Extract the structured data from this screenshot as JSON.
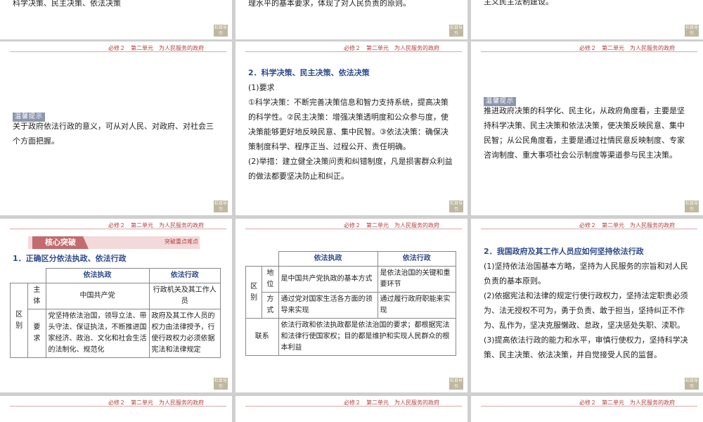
{
  "header_text": "必修２　第二单元　为人民服务的政府",
  "nav_label": "栏目导引",
  "slides": {
    "s1": {
      "text": "科学决策、民主决策、依法决策"
    },
    "s2": {
      "text": "理水平的基本要求，体现了对人民负责的原则。"
    },
    "s3": {
      "text": "主义民主法制建设。"
    },
    "s4": {
      "tip": "温馨提示",
      "lines": [
        "关于政府依法行政的意义，可从对人民、对政府、对社会三",
        "个方面把握。"
      ]
    },
    "s5": {
      "title": "2．科学决策、民主决策、依法决策",
      "lines": [
        "(1)要求",
        "①科学决策：不断完善决策信息和智力支持系统，提高决策",
        "的科学性。②民主决策：增强决策透明度和公众参与度，使",
        "决策能够更好地反映民意、集中民智。③依法决策：确保决",
        "策制度科学、程序正当、过程公开、责任明确。",
        "(2)举措：建立健全决策问责和纠错制度，凡是损害群众利益",
        "的做法都要坚决防止和纠正。"
      ]
    },
    "s6": {
      "tip": "温馨提示",
      "lines": [
        "推进政府决策的科学化、民主化，从政府角度看，主要是坚",
        "持科学决策、民主决策和依法决策，使决策反映民意、集中",
        "民智；从公民角度看，主要是通过社情民意反映制度、专家",
        "咨询制度、重大事项社会公示制度等渠道参与民主决策。"
      ]
    },
    "s7": {
      "core_title": "核心突破",
      "core_sub": "突破重点难点",
      "title": "1．正确区分依法执政、依法行政",
      "table": {
        "head": [
          "依法执政",
          "依法行政"
        ],
        "group": "区别",
        "row1_label": "主体",
        "row1": [
          "中国共产党",
          "行政机关及其工作人员"
        ],
        "row2_label": "要求",
        "row2": [
          "党坚持依法治国，领导立法、带头守法、保证执法，不断推进国家经济、政治、文化和社会生活的法制化、规范化",
          "政府及其工作人员的权力由法律授予，行使行政权力必须依据宪法和法律规定"
        ]
      }
    },
    "s8": {
      "table": {
        "head": [
          "依法执政",
          "依法行政"
        ],
        "group": "区别",
        "row1_label": "地位",
        "row1": [
          "是中国共产党执政的基本方式",
          "是依法治国的关键和重要环节"
        ],
        "row2_label": "方式",
        "row2": [
          "通过党对国家生活各方面的领导来实现",
          "通过履行政府职能来实现"
        ],
        "link_label": "联系",
        "link": "依法行政和依法执政都是依法治国的要求；都根据宪法和法律行使国家权；目的都是维护和实现人民群众的根本利益"
      }
    },
    "s9": {
      "title": "2．我国政府及其工作人员应如何坚持依法行政",
      "lines": [
        "(1)坚持依法治国基本方略，坚持为人民服务的宗旨和对人民",
        "负责的基本原则。",
        "(2)依据宪法和法律的规定行使行政权力，坚持法定职责必须",
        "为、法无授权不可为，勇于负责、敢于担当，坚持纠正不作",
        "为、乱作为，坚决克服懒政、怠政，坚决惩处失职、渎职。",
        "(3)提高依法行政的能力和水平，审慎行使权力，坚持科学决",
        "策、民主决策、依法决策，并自觉接受人民的监督。"
      ]
    }
  }
}
